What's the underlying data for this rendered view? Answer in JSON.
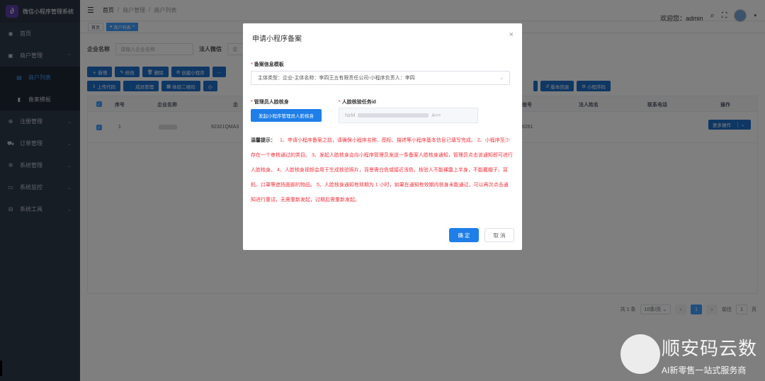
{
  "brand": {
    "title": "微信小程序管理系统"
  },
  "sidebar": {
    "items": [
      {
        "label": "首页",
        "icon": "dashboard-icon"
      },
      {
        "label": "商户管理",
        "icon": "shop-icon",
        "expanded": true
      },
      {
        "label": "商户列表",
        "sub": true,
        "active": true
      },
      {
        "label": "备案模板",
        "sub": true
      },
      {
        "label": "注册管理",
        "icon": "register-icon"
      },
      {
        "label": "订单管理",
        "icon": "cart-icon"
      },
      {
        "label": "系统管理",
        "icon": "settings-icon"
      },
      {
        "label": "系统监控",
        "icon": "monitor-icon"
      },
      {
        "label": "系统工具",
        "icon": "tools-icon"
      }
    ]
  },
  "header": {
    "breadcrumb": [
      "首页",
      "商户管理",
      "商户列表"
    ],
    "welcome": "欢迎您：admin"
  },
  "tags": [
    {
      "label": "首页"
    },
    {
      "label": "商户列表",
      "active": true
    }
  ],
  "filters": {
    "company_label": "企业名称",
    "company_placeholder": "请输入企业名称",
    "legal_label": "法人微信",
    "legal_placeholder": "请"
  },
  "toolbar": {
    "row1": [
      "新增",
      "修改",
      "删除",
      "创建小程序",
      "..."
    ],
    "row2": [
      "上传代码",
      "成员管理",
      "体验二维码",
      "小"
    ],
    "row2_right": [
      "版本回退",
      "小程序码"
    ]
  },
  "table": {
    "columns": [
      "序号",
      "企业名称",
      "企",
      "信号",
      "法人姓名",
      "联系电话",
      "操作"
    ],
    "rows": [
      {
        "index": "1",
        "code": "92321QMA3",
        "phone_tail": "6261",
        "action": "更多操作"
      }
    ]
  },
  "pagination": {
    "total": "共 1 条",
    "page_size": "10条/页",
    "current": "1",
    "goto_label": "前往",
    "goto_value": "1",
    "page_unit": "页"
  },
  "dialog": {
    "title": "申请小程序备案",
    "template_label": "备案信息模板",
    "template_value": "主体类型：企业-主体名称：李四王五有限责任公司-小程序负责人：李四",
    "face_label": "管理员人脸核身",
    "face_button": "发起小程序管理员人脸核身",
    "task_label": "人脸核验任务id",
    "task_prefix": "NzM",
    "task_suffix": "A==",
    "tips_label": "温馨提示：",
    "tips_text": "1、申请小程序备案之前，请确保小程序名称、图标、描述等小程序基本信息已填写完成。 2、小程序至少存在一个审核通过的类目。 3、发起人脸核身会向小程序管理员发送一条备案人脸核身通知，管理员点击该通知即可进行人脸核身。 4、人脸核身视频会用于生成核验照片，背景需白色或接近浅色，核验人不能裸露上半身，不能戴帽子、耳机、口罩等遮挡面部的物品。 5、人脸核身通知有效期为 1 小时，如果在通知有效期内核身未能通过，可以再次点击通知进行重试，无需重新发起，过期后需重新发起。",
    "ok": "确 定",
    "cancel": "取 消"
  },
  "watermark": {
    "title": "顺安码云数",
    "subtitle": "AI新零售一站式服务商"
  },
  "colors": {
    "primary": "#409eff",
    "sidebar": "#2f3a4b",
    "tips": "#f0303a"
  }
}
